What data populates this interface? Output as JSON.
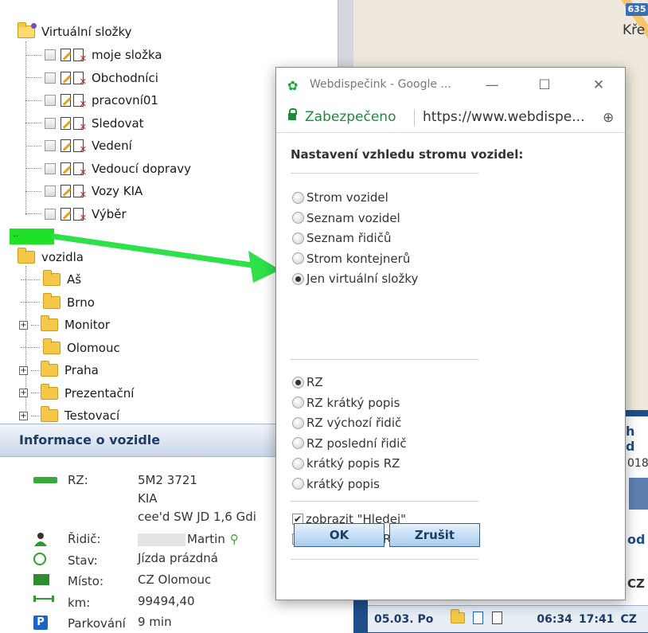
{
  "map": {
    "road_shield": "635",
    "town_fragment": "Kře"
  },
  "tree": {
    "virtual_root": "Virtuální složky",
    "virtual_items": [
      "moje složka",
      "Obchodníci",
      "pracovní01",
      "Sledovat",
      "Vedení",
      "Vedoucí dopravy",
      "Vozy KIA",
      "Výběr"
    ],
    "highlight_text": "..",
    "vehicles_root": "vozidla",
    "vehicle_folders": [
      {
        "label": "Aš",
        "expandable": false
      },
      {
        "label": "Brno",
        "expandable": false
      },
      {
        "label": "Monitor",
        "expandable": true
      },
      {
        "label": "Olomouc",
        "expandable": false
      },
      {
        "label": "Praha",
        "expandable": true
      },
      {
        "label": "Prezentační",
        "expandable": true
      },
      {
        "label": "Testovací",
        "expandable": true
      }
    ]
  },
  "info": {
    "title": "Informace o vozidle",
    "rz_label": "RZ:",
    "rz_value": "5M2 3721",
    "brand": "KIA",
    "model": "cee'd SW JD 1,6 Gdi",
    "driver_label": "Řidič:",
    "driver_value": "Martin",
    "state_label": "Stav:",
    "state_value": "Jízda prázdná",
    "place_label": "Místo:",
    "place_value": "CZ Olomouc",
    "km_label": "km:",
    "km_value": "99494,40",
    "parking_label": "Parkování",
    "parking_value": "9 min"
  },
  "right_panel": {
    "frag_top": "h d",
    "frag_year": "018",
    "frag_od": "od",
    "frag_cz": "CZ",
    "bottom_date": "05.03. Po",
    "bottom_time1": "06:34",
    "bottom_time2": "17:41",
    "bottom_cz": "CZ"
  },
  "popup": {
    "window_title": "Webdispečink - Google ...",
    "secure_label": "Zabezpečeno",
    "url": "https://www.webdispe...",
    "heading": "Nastavení vzhledu stromu vozidel:",
    "tree_options": [
      {
        "label": "Strom vozidel",
        "selected": false
      },
      {
        "label": "Seznam vozidel",
        "selected": false
      },
      {
        "label": "Seznam řidičů",
        "selected": false
      },
      {
        "label": "Strom kontejnerů",
        "selected": false
      },
      {
        "label": "Jen virtuální složky",
        "selected": true
      }
    ],
    "display_options": [
      {
        "label": "RZ",
        "selected": true
      },
      {
        "label": "RZ krátký popis",
        "selected": false
      },
      {
        "label": "RZ výchozí řidič",
        "selected": false
      },
      {
        "label": "RZ poslední řidič",
        "selected": false
      },
      {
        "label": "krátký popis RZ",
        "selected": false
      },
      {
        "label": "krátký popis",
        "selected": false
      }
    ],
    "checkboxes": [
      {
        "label": "zobrazit \"Hledej\"",
        "checked": true
      },
      {
        "label": "našeptávání RZ v \"Hledej\"",
        "checked": true
      }
    ],
    "ok_label": "OK",
    "cancel_label": "Zrušit"
  }
}
